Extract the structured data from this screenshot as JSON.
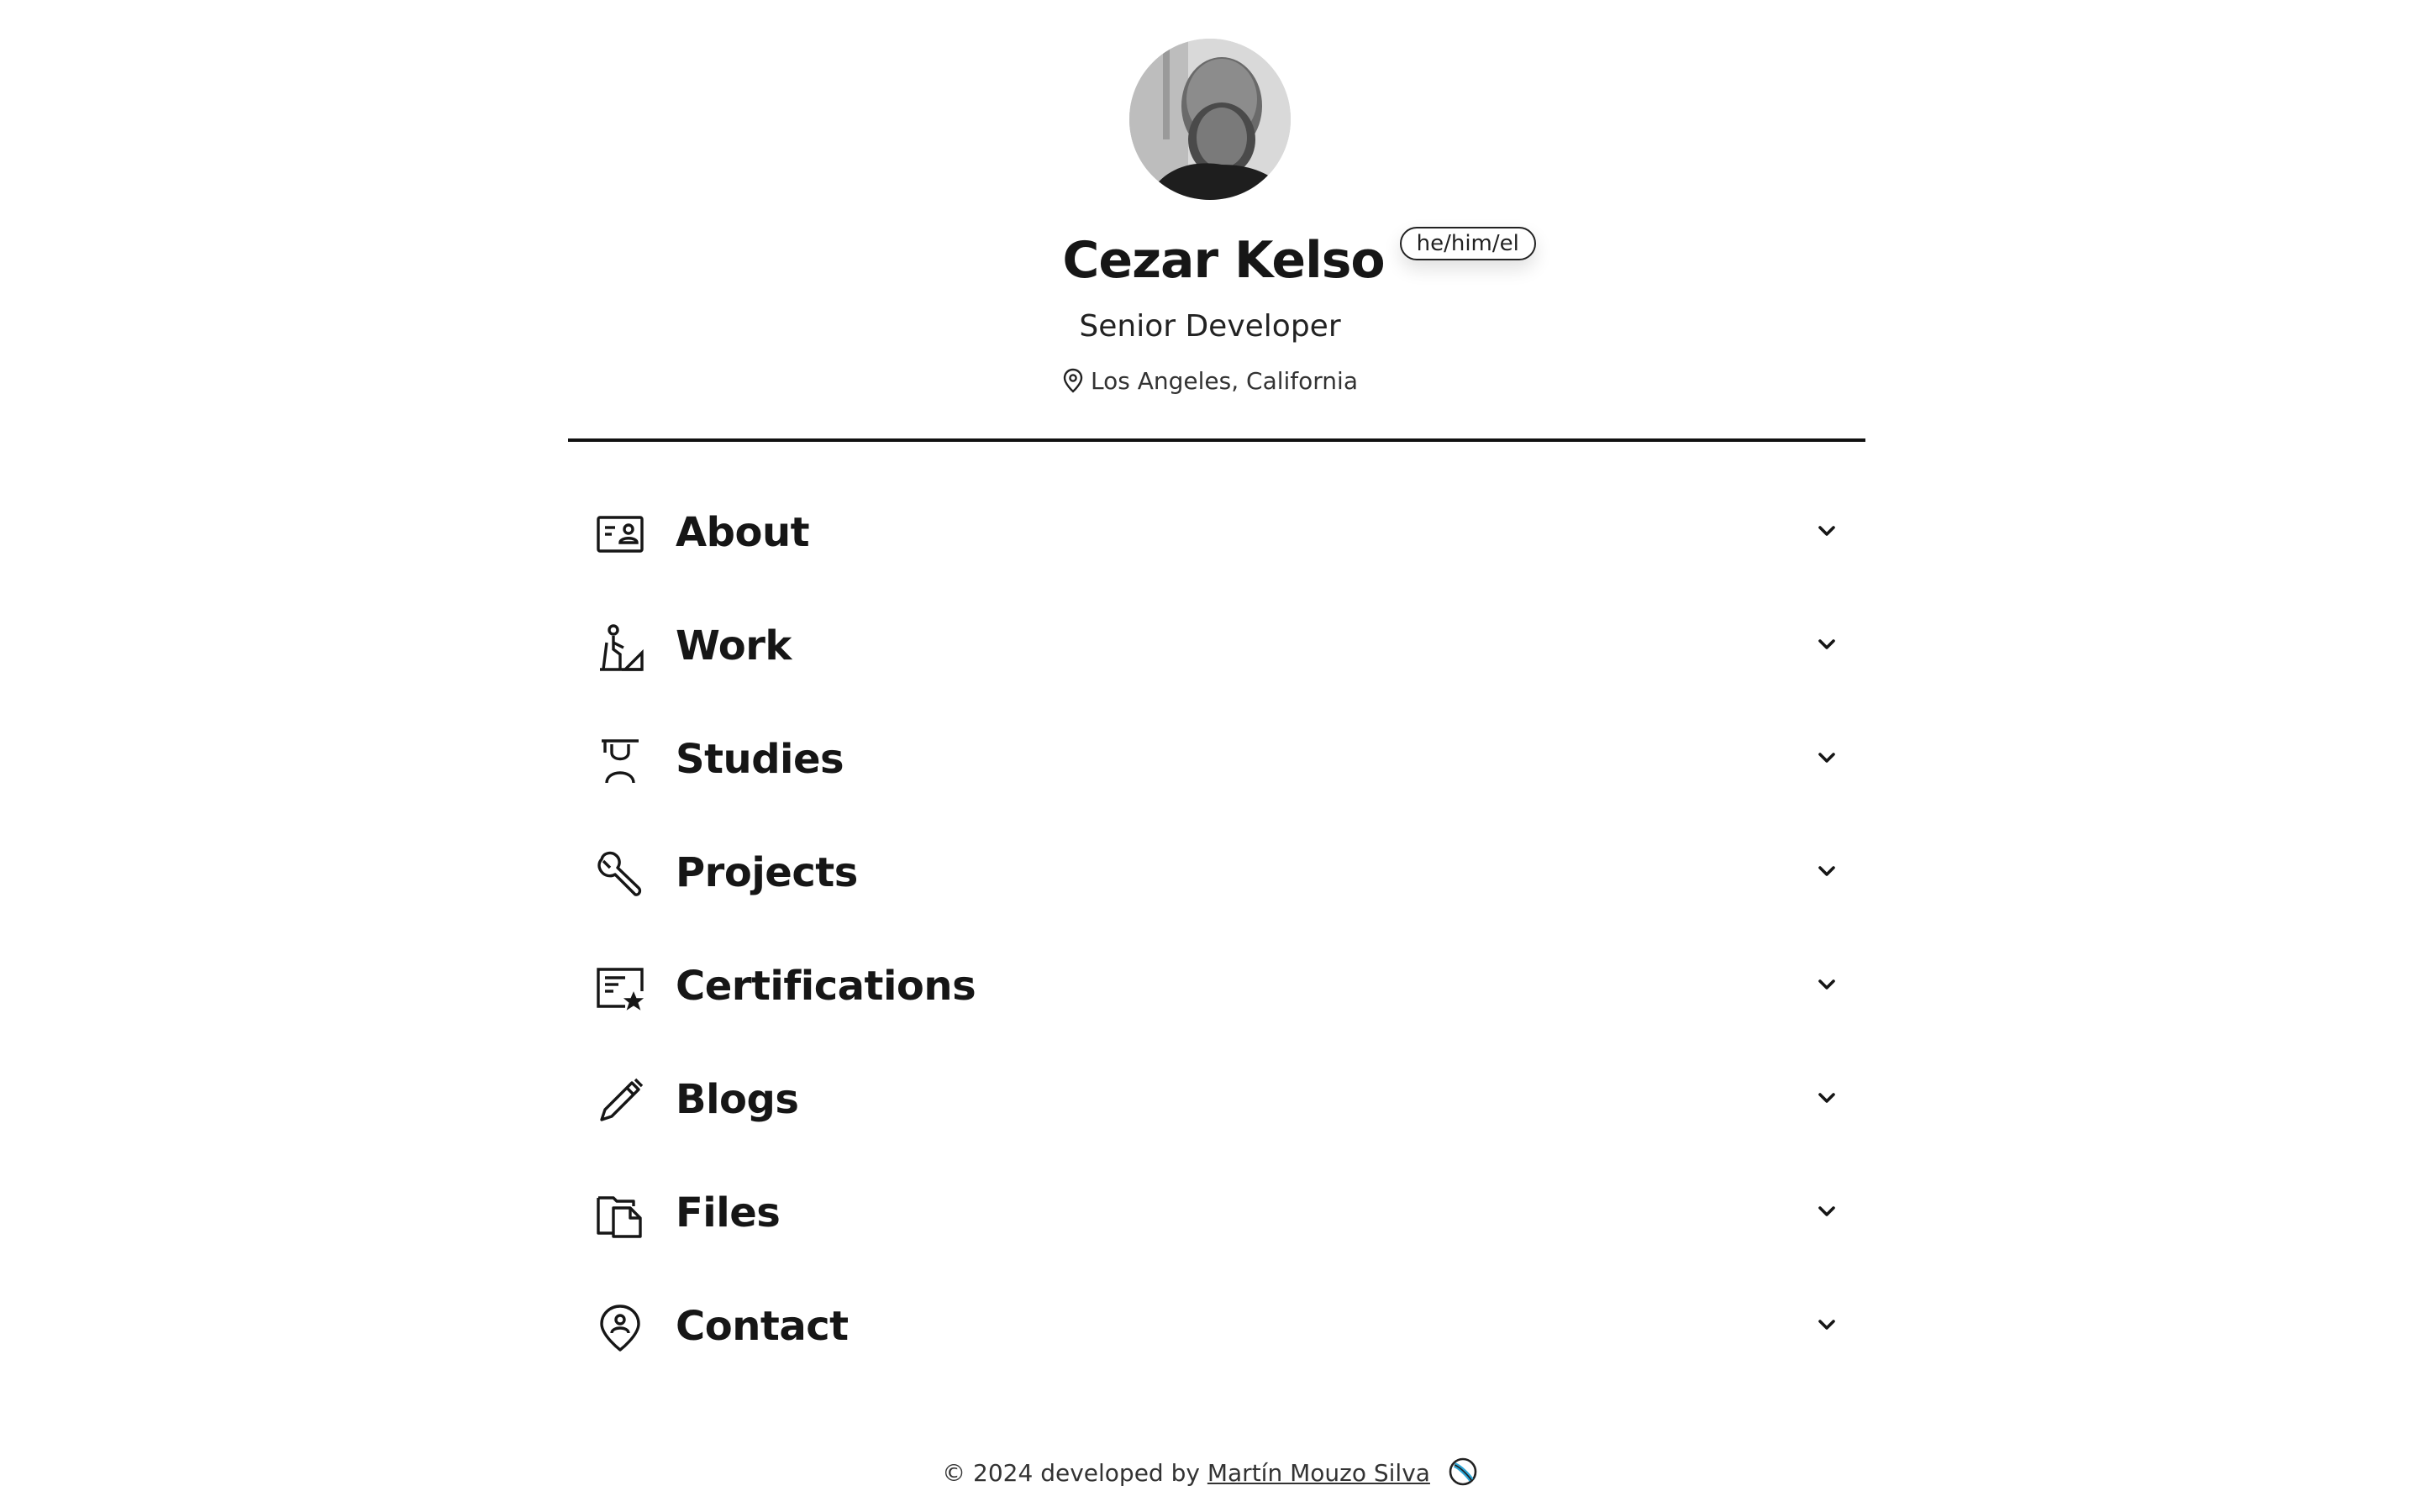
{
  "profile": {
    "name": "Cezar Kelso",
    "pronouns": "he/him/el",
    "job_title": "Senior Developer",
    "location": "Los Angeles, California",
    "avatar_icon": "profile-photo"
  },
  "sections": [
    {
      "label": "About",
      "icon": "id-card-icon"
    },
    {
      "label": "Work",
      "icon": "worker-icon"
    },
    {
      "label": "Studies",
      "icon": "student-icon"
    },
    {
      "label": "Projects",
      "icon": "wrench-icon"
    },
    {
      "label": "Certifications",
      "icon": "certificate-icon"
    },
    {
      "label": "Blogs",
      "icon": "pencil-icon"
    },
    {
      "label": "Files",
      "icon": "files-icon"
    },
    {
      "label": "Contact",
      "icon": "contact-pin-icon"
    }
  ],
  "footer": {
    "prefix": "© 2024 developed by",
    "author": "Martín Mouzo Silva",
    "badge_icon": "globe-icon"
  },
  "colors": {
    "text": "#161616",
    "background": "#ffffff",
    "divider": "#111111"
  }
}
